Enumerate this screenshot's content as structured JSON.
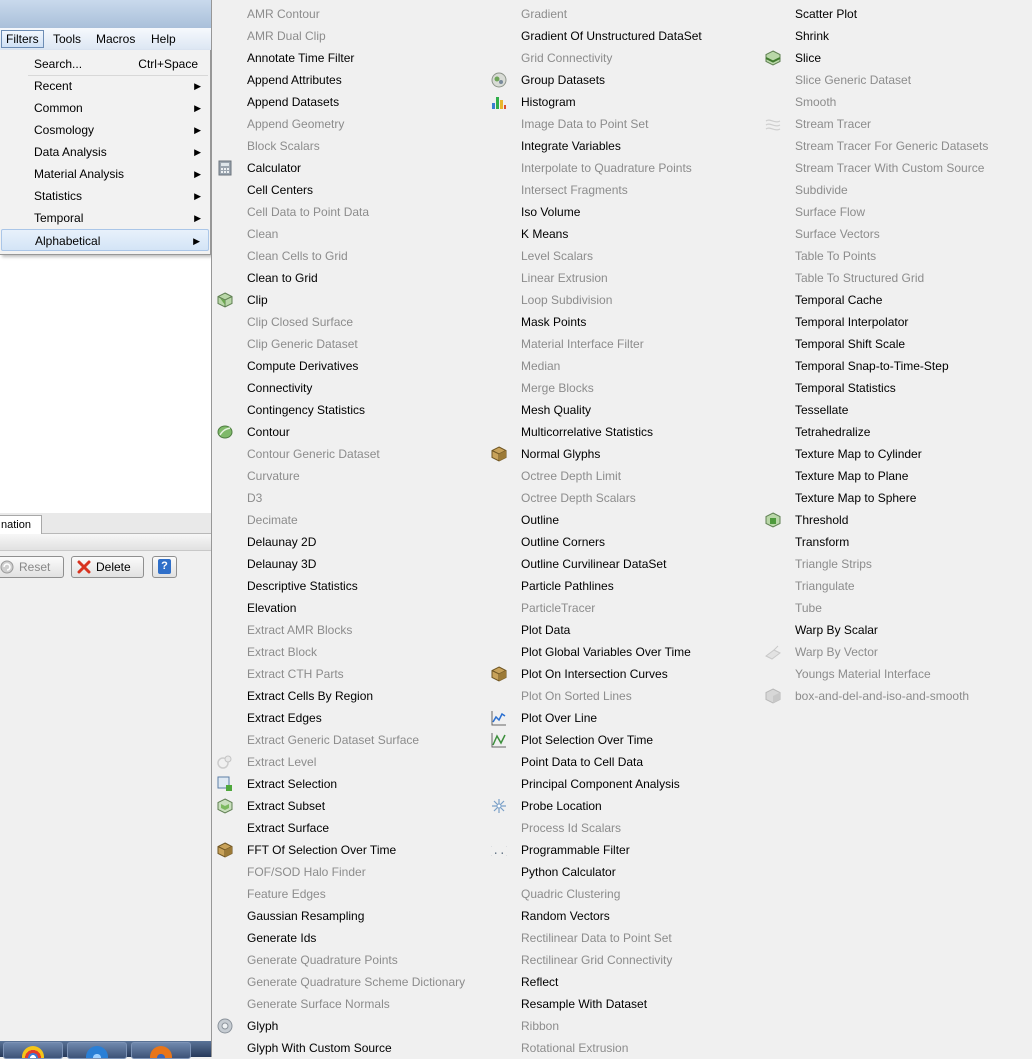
{
  "menubar": {
    "items": [
      {
        "label": "Filters",
        "active": true
      },
      {
        "label": "Tools"
      },
      {
        "label": "Macros"
      },
      {
        "label": "Help"
      }
    ]
  },
  "filters_menu": {
    "items": [
      {
        "label": "Search...",
        "shortcut": "Ctrl+Space"
      },
      {
        "label": "Recent",
        "submenu": true
      },
      {
        "label": "Common",
        "submenu": true
      },
      {
        "label": "Cosmology",
        "submenu": true
      },
      {
        "label": "Data Analysis",
        "submenu": true
      },
      {
        "label": "Material Analysis",
        "submenu": true
      },
      {
        "label": "Statistics",
        "submenu": true
      },
      {
        "label": "Temporal",
        "submenu": true
      },
      {
        "label": "Alphabetical",
        "submenu": true,
        "highlighted": true
      }
    ]
  },
  "panel": {
    "tab_label": "nation",
    "reset_label": "Reset",
    "delete_label": "Delete",
    "help_label": "?"
  },
  "alphabetical": {
    "columns": [
      [
        {
          "label": "AMR Contour",
          "enabled": false
        },
        {
          "label": "AMR Dual Clip",
          "enabled": false
        },
        {
          "label": "Annotate Time Filter",
          "enabled": true
        },
        {
          "label": "Append Attributes",
          "enabled": true
        },
        {
          "label": "Append Datasets",
          "enabled": true
        },
        {
          "label": "Append Geometry",
          "enabled": false
        },
        {
          "label": "Block Scalars",
          "enabled": false
        },
        {
          "label": "Calculator",
          "enabled": true,
          "icon": "calculator-icon"
        },
        {
          "label": "Cell Centers",
          "enabled": true
        },
        {
          "label": "Cell Data to Point Data",
          "enabled": false
        },
        {
          "label": "Clean",
          "enabled": false
        },
        {
          "label": "Clean Cells to Grid",
          "enabled": false
        },
        {
          "label": "Clean to Grid",
          "enabled": true
        },
        {
          "label": "Clip",
          "enabled": true,
          "icon": "clip-icon"
        },
        {
          "label": "Clip Closed Surface",
          "enabled": false
        },
        {
          "label": "Clip Generic Dataset",
          "enabled": false
        },
        {
          "label": "Compute Derivatives",
          "enabled": true
        },
        {
          "label": "Connectivity",
          "enabled": true
        },
        {
          "label": "Contingency Statistics",
          "enabled": true
        },
        {
          "label": "Contour",
          "enabled": true,
          "icon": "contour-icon"
        },
        {
          "label": "Contour Generic Dataset",
          "enabled": false
        },
        {
          "label": "Curvature",
          "enabled": false
        },
        {
          "label": "D3",
          "enabled": false
        },
        {
          "label": "Decimate",
          "enabled": false
        },
        {
          "label": "Delaunay 2D",
          "enabled": true
        },
        {
          "label": "Delaunay 3D",
          "enabled": true
        },
        {
          "label": "Descriptive Statistics",
          "enabled": true
        },
        {
          "label": "Elevation",
          "enabled": true
        },
        {
          "label": "Extract AMR Blocks",
          "enabled": false
        },
        {
          "label": "Extract Block",
          "enabled": false
        },
        {
          "label": "Extract CTH Parts",
          "enabled": false
        },
        {
          "label": "Extract Cells By Region",
          "enabled": true
        },
        {
          "label": "Extract Edges",
          "enabled": true
        },
        {
          "label": "Extract Generic Dataset Surface",
          "enabled": false
        },
        {
          "label": "Extract Level",
          "enabled": false,
          "icon": "extract-level-icon"
        },
        {
          "label": "Extract Selection",
          "enabled": true,
          "icon": "extract-selection-icon"
        },
        {
          "label": "Extract Subset",
          "enabled": true,
          "icon": "extract-subset-icon"
        },
        {
          "label": "Extract Surface",
          "enabled": true
        },
        {
          "label": "FFT Of Selection Over Time",
          "enabled": true,
          "icon": "cube-icon"
        },
        {
          "label": "FOF/SOD Halo Finder",
          "enabled": false
        },
        {
          "label": "Feature Edges",
          "enabled": false
        },
        {
          "label": "Gaussian Resampling",
          "enabled": true
        },
        {
          "label": "Generate Ids",
          "enabled": true
        },
        {
          "label": "Generate Quadrature Points",
          "enabled": false
        },
        {
          "label": "Generate Quadrature Scheme Dictionary",
          "enabled": false
        },
        {
          "label": "Generate Surface Normals",
          "enabled": false
        },
        {
          "label": "Glyph",
          "enabled": true,
          "icon": "glyph-icon"
        },
        {
          "label": "Glyph With Custom Source",
          "enabled": true
        }
      ],
      [
        {
          "label": "Gradient",
          "enabled": false
        },
        {
          "label": "Gradient Of Unstructured DataSet",
          "enabled": true
        },
        {
          "label": "Grid Connectivity",
          "enabled": false
        },
        {
          "label": "Group Datasets",
          "enabled": true,
          "icon": "group-datasets-icon"
        },
        {
          "label": "Histogram",
          "enabled": true,
          "icon": "histogram-icon"
        },
        {
          "label": "Image Data to Point Set",
          "enabled": false
        },
        {
          "label": "Integrate Variables",
          "enabled": true
        },
        {
          "label": "Interpolate to Quadrature Points",
          "enabled": false
        },
        {
          "label": "Intersect Fragments",
          "enabled": false
        },
        {
          "label": "Iso Volume",
          "enabled": true
        },
        {
          "label": "K Means",
          "enabled": true
        },
        {
          "label": "Level Scalars",
          "enabled": false
        },
        {
          "label": "Linear Extrusion",
          "enabled": false
        },
        {
          "label": "Loop Subdivision",
          "enabled": false
        },
        {
          "label": "Mask Points",
          "enabled": true
        },
        {
          "label": "Material Interface Filter",
          "enabled": false
        },
        {
          "label": "Median",
          "enabled": false
        },
        {
          "label": "Merge Blocks",
          "enabled": false
        },
        {
          "label": "Mesh Quality",
          "enabled": true
        },
        {
          "label": "Multicorrelative Statistics",
          "enabled": true
        },
        {
          "label": "Normal Glyphs",
          "enabled": true,
          "icon": "cube-icon"
        },
        {
          "label": "Octree Depth Limit",
          "enabled": false
        },
        {
          "label": "Octree Depth Scalars",
          "enabled": false
        },
        {
          "label": "Outline",
          "enabled": true
        },
        {
          "label": "Outline Corners",
          "enabled": true
        },
        {
          "label": "Outline Curvilinear DataSet",
          "enabled": true
        },
        {
          "label": "Particle Pathlines",
          "enabled": true
        },
        {
          "label": "ParticleTracer",
          "enabled": false
        },
        {
          "label": "Plot Data",
          "enabled": true
        },
        {
          "label": "Plot Global Variables Over Time",
          "enabled": true
        },
        {
          "label": "Plot On Intersection Curves",
          "enabled": true,
          "icon": "cube-icon"
        },
        {
          "label": "Plot On Sorted Lines",
          "enabled": false
        },
        {
          "label": "Plot Over Line",
          "enabled": true,
          "icon": "plot-line-icon"
        },
        {
          "label": "Plot Selection Over Time",
          "enabled": true,
          "icon": "plot-selection-icon"
        },
        {
          "label": "Point Data to Cell Data",
          "enabled": true
        },
        {
          "label": "Principal Component Analysis",
          "enabled": true
        },
        {
          "label": "Probe Location",
          "enabled": true,
          "icon": "probe-icon"
        },
        {
          "label": "Process Id Scalars",
          "enabled": false
        },
        {
          "label": "Programmable Filter",
          "enabled": true,
          "icon": "programmable-icon"
        },
        {
          "label": "Python Calculator",
          "enabled": true
        },
        {
          "label": "Quadric Clustering",
          "enabled": false
        },
        {
          "label": "Random Vectors",
          "enabled": true
        },
        {
          "label": "Rectilinear Data to Point Set",
          "enabled": false
        },
        {
          "label": "Rectilinear Grid Connectivity",
          "enabled": false
        },
        {
          "label": "Reflect",
          "enabled": true
        },
        {
          "label": "Resample With Dataset",
          "enabled": true
        },
        {
          "label": "Ribbon",
          "enabled": false
        },
        {
          "label": "Rotational Extrusion",
          "enabled": false
        }
      ],
      [
        {
          "label": "Scatter Plot",
          "enabled": true
        },
        {
          "label": "Shrink",
          "enabled": true
        },
        {
          "label": "Slice",
          "enabled": true,
          "icon": "slice-icon"
        },
        {
          "label": "Slice Generic Dataset",
          "enabled": false
        },
        {
          "label": "Smooth",
          "enabled": false
        },
        {
          "label": "Stream Tracer",
          "enabled": false,
          "icon": "stream-tracer-icon"
        },
        {
          "label": "Stream Tracer For Generic Datasets",
          "enabled": false
        },
        {
          "label": "Stream Tracer With Custom Source",
          "enabled": false
        },
        {
          "label": "Subdivide",
          "enabled": false
        },
        {
          "label": "Surface Flow",
          "enabled": false
        },
        {
          "label": "Surface Vectors",
          "enabled": false
        },
        {
          "label": "Table To Points",
          "enabled": false
        },
        {
          "label": "Table To Structured Grid",
          "enabled": false
        },
        {
          "label": "Temporal Cache",
          "enabled": true
        },
        {
          "label": "Temporal Interpolator",
          "enabled": true
        },
        {
          "label": "Temporal Shift Scale",
          "enabled": true
        },
        {
          "label": "Temporal Snap-to-Time-Step",
          "enabled": true
        },
        {
          "label": "Temporal Statistics",
          "enabled": true
        },
        {
          "label": "Tessellate",
          "enabled": true
        },
        {
          "label": "Tetrahedralize",
          "enabled": true
        },
        {
          "label": "Texture Map to Cylinder",
          "enabled": true
        },
        {
          "label": "Texture Map to Plane",
          "enabled": true
        },
        {
          "label": "Texture Map to Sphere",
          "enabled": true
        },
        {
          "label": "Threshold",
          "enabled": true,
          "icon": "threshold-icon"
        },
        {
          "label": "Transform",
          "enabled": true
        },
        {
          "label": "Triangle Strips",
          "enabled": false
        },
        {
          "label": "Triangulate",
          "enabled": false
        },
        {
          "label": "Tube",
          "enabled": false
        },
        {
          "label": "Warp By Scalar",
          "enabled": true
        },
        {
          "label": "Warp By Vector",
          "enabled": false,
          "icon": "warp-vector-icon"
        },
        {
          "label": "Youngs Material Interface",
          "enabled": false
        },
        {
          "label": "box-and-del-and-iso-and-smooth",
          "enabled": false,
          "icon": "custom-filter-icon"
        }
      ]
    ]
  },
  "colors": {
    "enabled_text": "#000000",
    "disabled_text": "#8c8c8c",
    "menu_bg": "#f0f0f0",
    "highlight_bg": "#d4e4f6"
  }
}
